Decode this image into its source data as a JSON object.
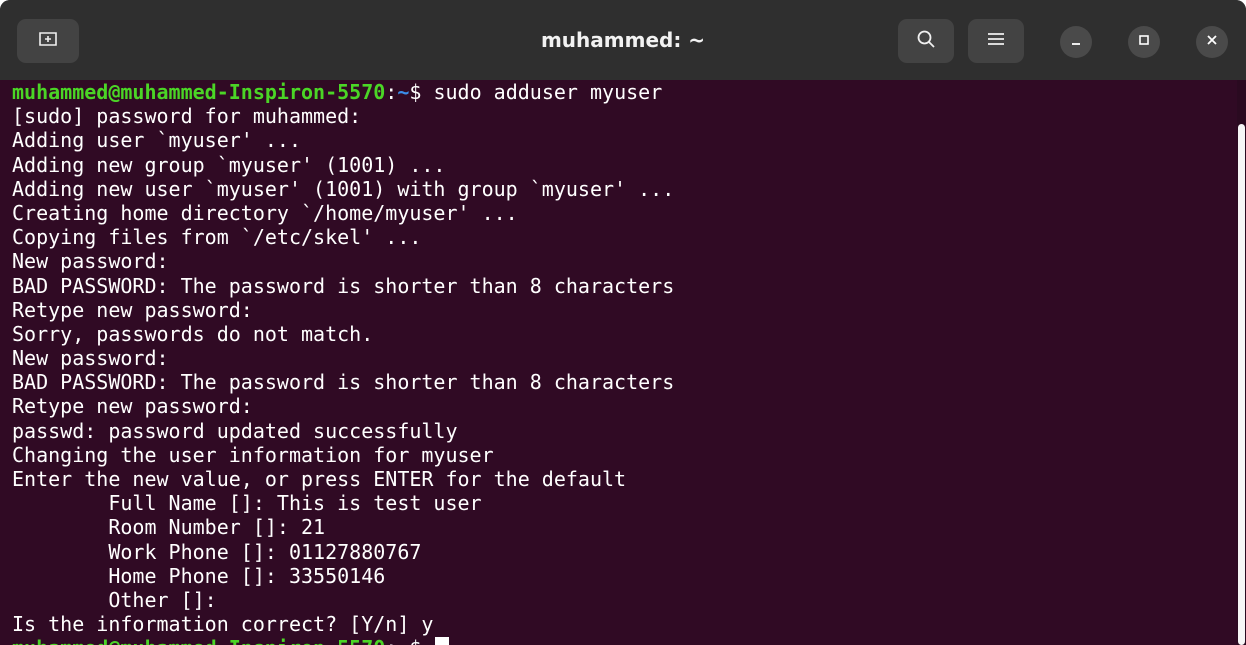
{
  "window": {
    "title": "muhammed: ~"
  },
  "icons": {
    "new_tab": "new-tab-icon",
    "search": "search-icon",
    "menu": "hamburger-menu-icon",
    "minimize": "minimize-icon",
    "maximize": "maximize-icon",
    "close": "close-icon"
  },
  "colors": {
    "terminal_bg": "#300a24",
    "titlebar_bg": "#2f2f2f",
    "prompt_user": "#4bd526",
    "prompt_path": "#3b8eea",
    "text": "#ffffff"
  },
  "prompt": {
    "user_host": "muhammed@muhammed-Inspiron-5570",
    "separator": ":",
    "path": "~",
    "symbol": "$"
  },
  "terminal": {
    "command": " sudo adduser myuser",
    "output": [
      "[sudo] password for muhammed:",
      "Adding user `myuser' ...",
      "Adding new group `myuser' (1001) ...",
      "Adding new user `myuser' (1001) with group `myuser' ...",
      "Creating home directory `/home/myuser' ...",
      "Copying files from `/etc/skel' ...",
      "New password:",
      "BAD PASSWORD: The password is shorter than 8 characters",
      "Retype new password:",
      "Sorry, passwords do not match.",
      "New password:",
      "BAD PASSWORD: The password is shorter than 8 characters",
      "Retype new password:",
      "passwd: password updated successfully",
      "Changing the user information for myuser",
      "Enter the new value, or press ENTER for the default",
      "        Full Name []: This is test user",
      "        Room Number []: 21",
      "        Work Phone []: 01127880767",
      "        Home Phone []: 33550146",
      "        Other []:",
      "Is the information correct? [Y/n] y"
    ],
    "final_prompt_input": " "
  }
}
